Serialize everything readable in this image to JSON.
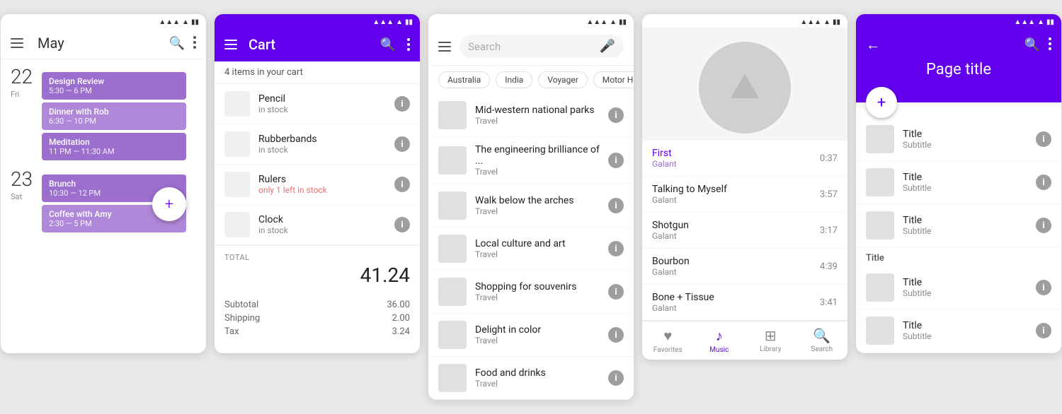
{
  "screen1": {
    "title": "May",
    "dates": [
      {
        "num": "22",
        "day": "Fri",
        "events": [
          {
            "name": "Design Review",
            "time": "5:30 — 6 PM"
          },
          {
            "name": "Dinner with Rob",
            "time": "6:30 — 10 PM"
          },
          {
            "name": "Meditation",
            "time": "11 PM — 11:30 AM"
          }
        ]
      },
      {
        "num": "23",
        "day": "Sat",
        "events": [
          {
            "name": "Brunch",
            "time": "10:30 — 12 PM"
          },
          {
            "name": "Coffee with Amy",
            "time": "2:30 — 5 PM"
          }
        ]
      }
    ],
    "fab_label": "+"
  },
  "screen2": {
    "title": "Cart",
    "count_label": "4 items in your cart",
    "items": [
      {
        "name": "Pencil",
        "stock": "in stock",
        "low": false
      },
      {
        "name": "Rubberbands",
        "stock": "in stock",
        "low": false
      },
      {
        "name": "Rulers",
        "stock": "only 1 left in stock",
        "low": true
      },
      {
        "name": "Clock",
        "stock": "in stock",
        "low": false
      }
    ],
    "total_label": "TOTAL",
    "total_amount": "41.24",
    "subtotal_label": "Subtotal",
    "subtotal_value": "36.00",
    "shipping_label": "Shipping",
    "shipping_value": "2.00",
    "tax_label": "Tax",
    "tax_value": "3.24"
  },
  "screen3": {
    "search_placeholder": "Search",
    "chips": [
      "Australia",
      "India",
      "Voyager",
      "Motor Hom"
    ],
    "items": [
      {
        "title": "Mid-western national parks",
        "subtitle": "Travel"
      },
      {
        "title": "The engineering brilliance of ...",
        "subtitle": "Travel"
      },
      {
        "title": "Walk below the arches",
        "subtitle": "Travel"
      },
      {
        "title": "Local culture and art",
        "subtitle": "Travel"
      },
      {
        "title": "Shopping for souvenirs",
        "subtitle": "Travel"
      },
      {
        "title": "Delight in color",
        "subtitle": "Travel"
      },
      {
        "title": "Food and drinks",
        "subtitle": "Travel"
      }
    ]
  },
  "screen4": {
    "items": [
      {
        "title": "First",
        "artist": "Galant",
        "duration": "0:37",
        "playing": true
      },
      {
        "title": "Talking to Myself",
        "artist": "Galant",
        "duration": "3:57",
        "playing": false
      },
      {
        "title": "Shotgun",
        "artist": "Galant",
        "duration": "3:17",
        "playing": false
      },
      {
        "title": "Bourbon",
        "artist": "Galant",
        "duration": "4:39",
        "playing": false
      },
      {
        "title": "Bone + Tissue",
        "artist": "Galant",
        "duration": "3:41",
        "playing": false
      }
    ],
    "nav": [
      {
        "label": "Favorites",
        "icon": "♥",
        "active": false
      },
      {
        "label": "Music",
        "icon": "♪",
        "active": true
      },
      {
        "label": "Library",
        "icon": "▦",
        "active": false
      },
      {
        "label": "Search",
        "icon": "⌕",
        "active": false
      }
    ]
  },
  "screen5": {
    "page_title": "Page title",
    "fab_label": "+",
    "sections": [
      {
        "header": null,
        "items": [
          {
            "title": "Title",
            "subtitle": "Subtitle"
          },
          {
            "title": "Title",
            "subtitle": "Subtitle"
          },
          {
            "title": "Title",
            "subtitle": "Subtitle"
          }
        ]
      },
      {
        "header": "Title",
        "items": [
          {
            "title": "Title",
            "subtitle": "Subtitle"
          },
          {
            "title": "Title",
            "subtitle": "Subtitle"
          }
        ]
      }
    ]
  }
}
